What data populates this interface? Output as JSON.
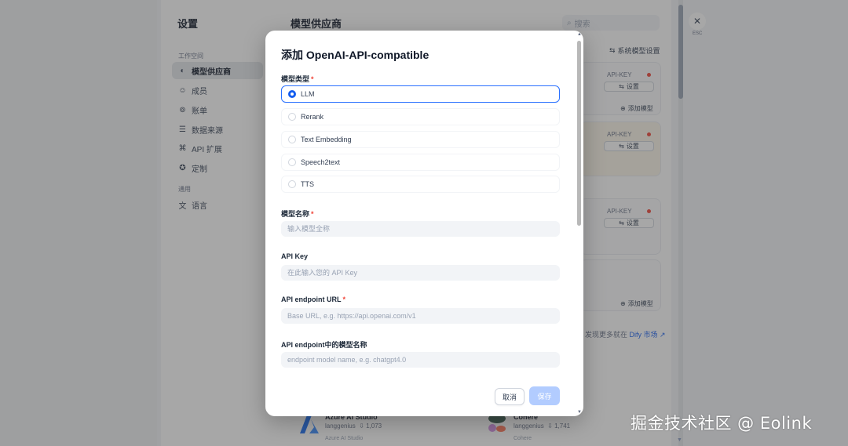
{
  "settings": {
    "title": "设置",
    "workspace_label": "工作空间",
    "general_label": "通用",
    "nav": [
      {
        "label": "模型供应商",
        "icon": "cube-icon"
      },
      {
        "label": "成员",
        "icon": "members-icon"
      },
      {
        "label": "账单",
        "icon": "billing-icon"
      },
      {
        "label": "数据来源",
        "icon": "database-icon"
      },
      {
        "label": "API 扩展",
        "icon": "api-extension-icon"
      },
      {
        "label": "定制",
        "icon": "customize-icon"
      }
    ],
    "language_label": "语言"
  },
  "providers": {
    "title": "模型供应商",
    "search_placeholder": "搜索",
    "system_model_settings": "系统模型设置",
    "api_key_label": "API-KEY",
    "settings_button": "设置",
    "add_model": "添加模型",
    "discover_prefix": "发现更多就在 ",
    "discover_link": "Dify 市场",
    "bottom_cards": [
      {
        "name": "Azure AI Studio",
        "author": "langgenius",
        "count": "1,073",
        "sub": "Azure AI Studio"
      },
      {
        "name": "Cohere",
        "author": "langgenius",
        "count": "1,741",
        "sub": "Cohere"
      }
    ]
  },
  "close": {
    "esc_label": "ESC"
  },
  "modal": {
    "title": "添加 OpenAI-API-compatible",
    "model_type_label": "模型类型",
    "model_types": [
      {
        "label": "LLM",
        "selected": true
      },
      {
        "label": "Rerank",
        "selected": false
      },
      {
        "label": "Text Embedding",
        "selected": false
      },
      {
        "label": "Speech2text",
        "selected": false
      },
      {
        "label": "TTS",
        "selected": false
      }
    ],
    "model_name_label": "模型名称",
    "model_name_placeholder": "输入模型全称",
    "api_key_label": "API Key",
    "api_key_placeholder": "在此输入您的 API Key",
    "endpoint_url_label": "API endpoint URL",
    "endpoint_url_placeholder": "Base URL, e.g. https://api.openai.com/v1",
    "endpoint_model_label": "API endpoint中的模型名称",
    "endpoint_model_placeholder": "endpoint model name, e.g. chatgpt4.0",
    "cancel": "取消",
    "save": "保存",
    "required_mark": "*"
  },
  "watermark": "掘金技术社区 @ Eolink",
  "colors": {
    "accent": "#155eef",
    "required": "#f04438"
  }
}
